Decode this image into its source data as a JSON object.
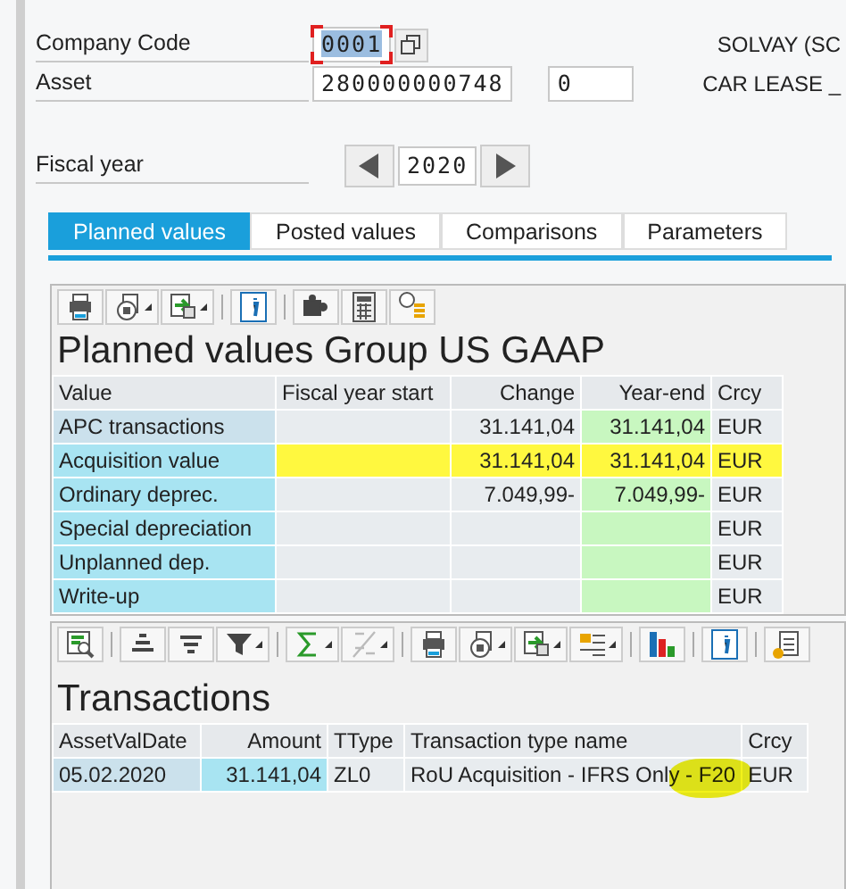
{
  "header": {
    "fields": [
      {
        "label": "Company Code",
        "value": "0001",
        "focused": true,
        "description": "SOLVAY (SC"
      },
      {
        "label": "Asset",
        "value": "280000000748",
        "sub_number": "0",
        "focused": false,
        "description": "CAR LEASE _"
      }
    ],
    "fiscal_year": {
      "label": "Fiscal year",
      "value": "2020"
    }
  },
  "tabs": [
    {
      "label": "Planned values",
      "selected": true
    },
    {
      "label": "Posted values",
      "selected": false
    },
    {
      "label": "Comparisons",
      "selected": false
    },
    {
      "label": "Parameters",
      "selected": false
    }
  ],
  "planned_values": {
    "title": "Planned values Group US GAAP",
    "columns": [
      {
        "label": "Value",
        "kind": "label"
      },
      {
        "label": "Fiscal year start",
        "kind": "data"
      },
      {
        "label": "Change",
        "kind": "data"
      },
      {
        "label": "Year-end",
        "kind": "year_end"
      },
      {
        "label": "Crcy",
        "kind": "currency"
      }
    ],
    "rows": [
      {
        "kind": "summary",
        "highlighted": false,
        "cells": [
          "APC transactions",
          "",
          "31.141,04",
          "31.141,04",
          "EUR"
        ]
      },
      {
        "kind": "item",
        "highlighted": true,
        "cells": [
          "Acquisition value",
          "",
          "31.141,04",
          "31.141,04",
          "EUR"
        ]
      },
      {
        "kind": "item",
        "highlighted": false,
        "cells": [
          "Ordinary deprec.",
          "",
          "7.049,99-",
          "7.049,99-",
          "EUR"
        ]
      },
      {
        "kind": "item",
        "highlighted": false,
        "cells": [
          "Special depreciation",
          "",
          "",
          "",
          "EUR"
        ]
      },
      {
        "kind": "item",
        "highlighted": false,
        "cells": [
          "Unplanned dep.",
          "",
          "",
          "",
          "EUR"
        ]
      },
      {
        "kind": "item",
        "highlighted": false,
        "cells": [
          "Write-up",
          "",
          "",
          "",
          "EUR"
        ]
      }
    ]
  },
  "transactions": {
    "title": "Transactions",
    "columns": [
      {
        "label": "AssetValDate",
        "kind": "key"
      },
      {
        "label": "Amount",
        "kind": "amount"
      },
      {
        "label": "TType",
        "kind": "text"
      },
      {
        "label": "Transaction type name",
        "kind": "text"
      },
      {
        "label": "Crcy",
        "kind": "text"
      }
    ],
    "rows": [
      {
        "cells": [
          "05.02.2020",
          "31.141,04",
          "ZL0",
          "RoU Acquisition - IFRS Only - F20",
          "EUR"
        ]
      }
    ]
  }
}
